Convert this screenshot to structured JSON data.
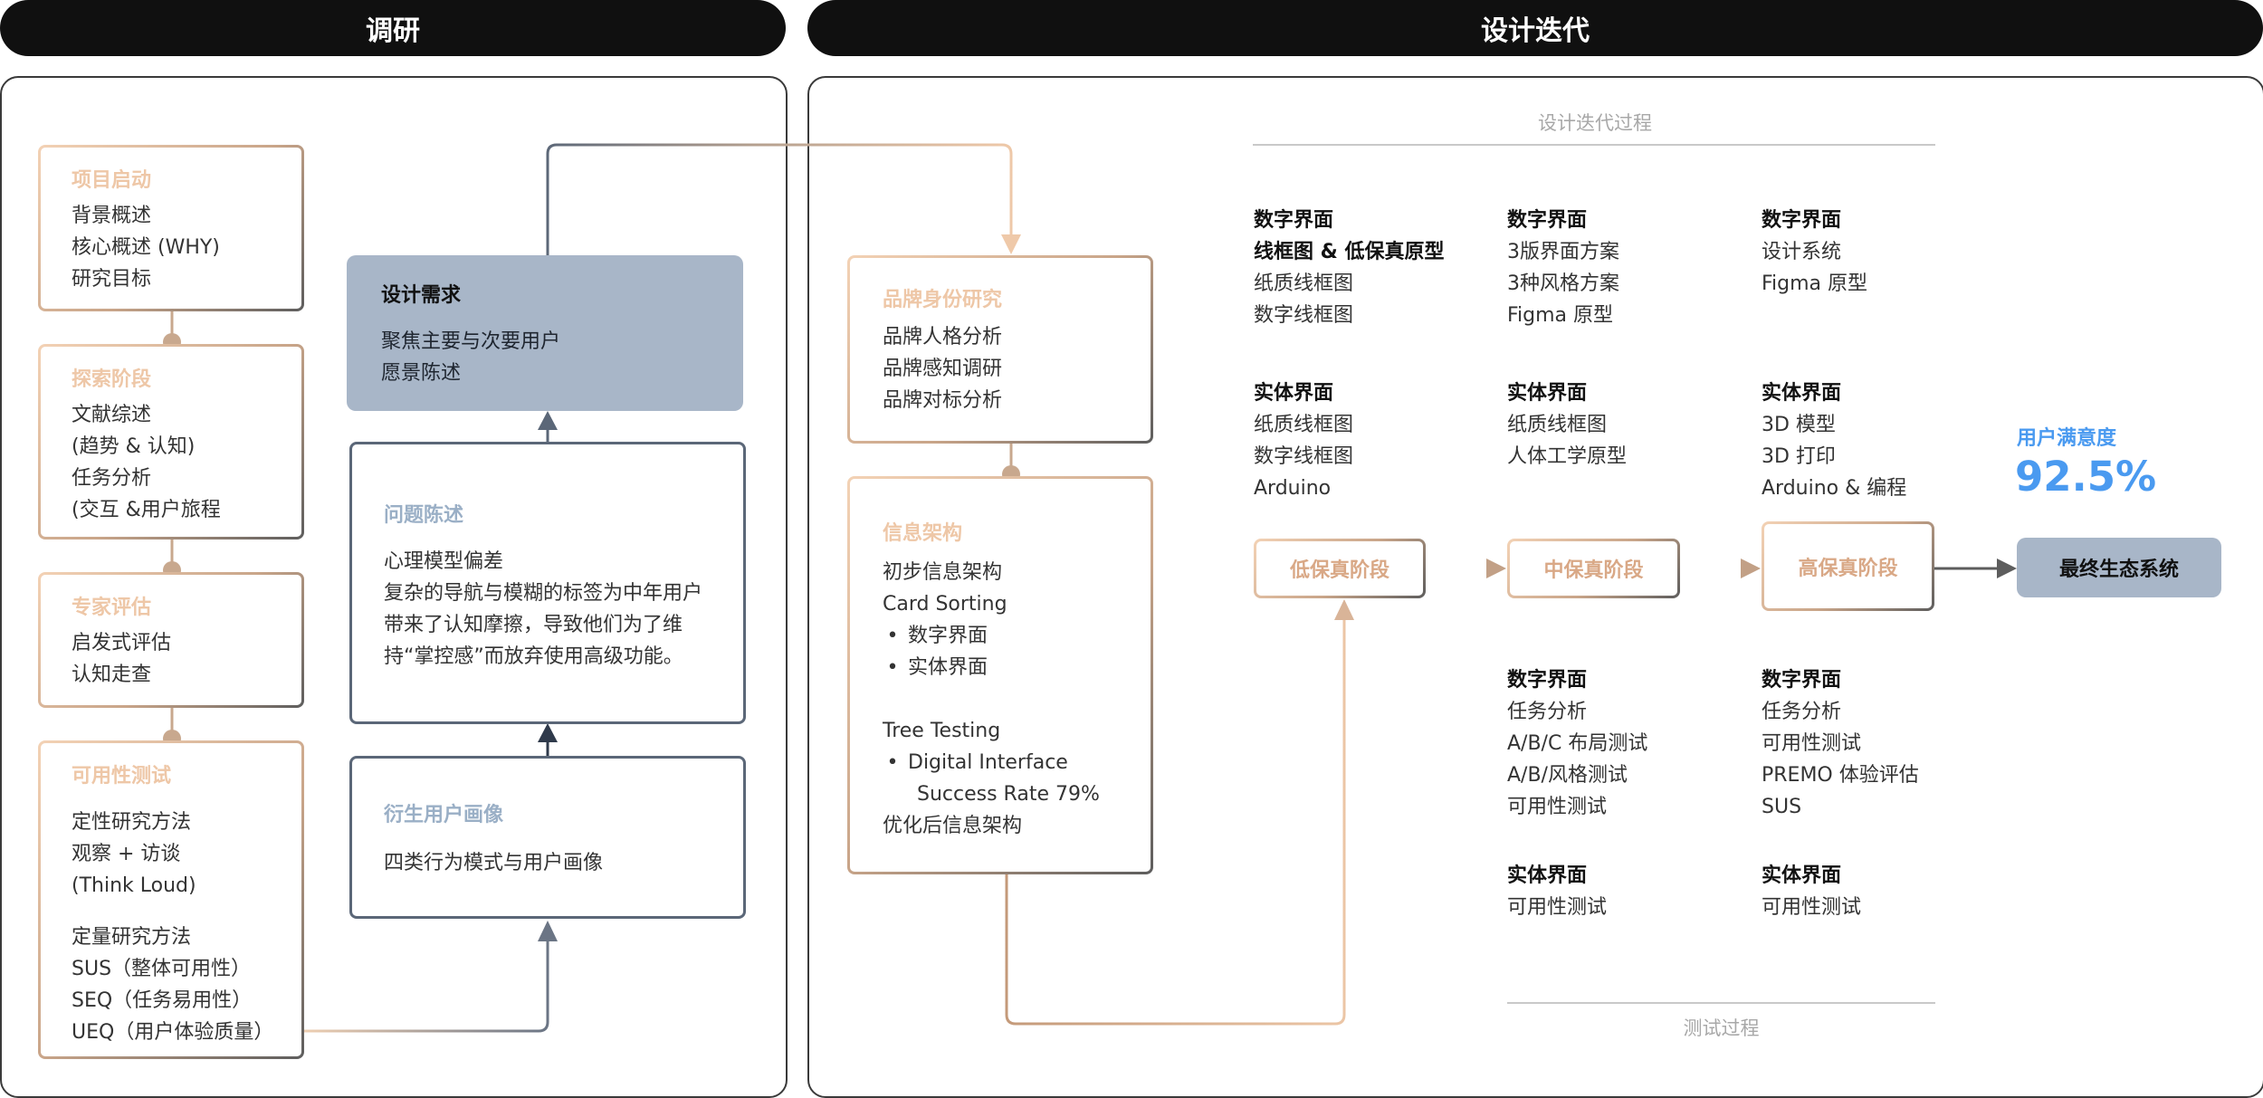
{
  "headers": {
    "research": "调研",
    "design": "设计迭代"
  },
  "research": {
    "kickoff": {
      "title": "项目启动",
      "lines": [
        "背景概述",
        "核心概述 (WHY)",
        "研究目标"
      ]
    },
    "explore": {
      "title": "探索阶段",
      "lines": [
        "文献综述",
        "(趋势 & 认知)",
        "任务分析",
        "(交互 &用户旅程"
      ]
    },
    "expert": {
      "title": "专家评估",
      "lines": [
        "启发式评估",
        "认知走查"
      ]
    },
    "usability": {
      "title": "可用性测试",
      "qual": [
        "定性研究方法",
        "观察 + 访谈",
        "(Think Loud)"
      ],
      "quant": [
        "定量研究方法",
        "SUS（整体可用性）",
        "SEQ（任务易用性）",
        "UEQ（用户体验质量）"
      ]
    },
    "requirements": {
      "title": "设计需求",
      "lines": [
        "聚焦主要与次要用户",
        "愿景陈述"
      ]
    },
    "problem": {
      "title": "问题陈述",
      "lines": [
        "心理模型偏差",
        "复杂的导航与模糊的标签为中年用户",
        "带来了认知摩擦，导致他们为了维",
        "持“掌控感”而放弃使用高级功能。"
      ]
    },
    "persona": {
      "title": "衍生用户画像",
      "lines": [
        "四类行为模式与用户画像"
      ]
    }
  },
  "design": {
    "process_caption": "设计迭代过程",
    "test_caption": "测试过程",
    "brand": {
      "title": "品牌身份研究",
      "lines": [
        "品牌人格分析",
        "品牌感知调研",
        "品牌对标分析"
      ]
    },
    "ia": {
      "title": "信息架构",
      "line1": "初步信息架构",
      "line2": "Card Sorting",
      "bullets1": [
        "数字界面",
        "实体界面"
      ],
      "line3": "Tree Testing",
      "bullet2a": "Digital Interface",
      "bullet2b": "Success Rate 79%",
      "line4": "优化后信息架构"
    },
    "stages": {
      "low": "低保真阶段",
      "mid": "中保真阶段",
      "high": "高保真阶段",
      "final": "最终生态系统"
    },
    "satisfaction": {
      "label": "用户满意度",
      "value": "92.5%"
    },
    "low_digital": {
      "head": "数字界面",
      "subhead": "线框图 & 低保真原型",
      "lines": [
        "纸质线框图",
        "数字线框图"
      ]
    },
    "low_physical": {
      "head": "实体界面",
      "lines": [
        "纸质线框图",
        "数字线框图",
        "Arduino"
      ]
    },
    "mid_digital": {
      "head": "数字界面",
      "lines": [
        "3版界面方案",
        "3种风格方案",
        "Figma 原型"
      ]
    },
    "mid_physical": {
      "head": "实体界面",
      "lines": [
        "纸质线框图",
        "人体工学原型"
      ]
    },
    "high_digital": {
      "head": "数字界面",
      "lines": [
        "设计系统",
        "Figma 原型"
      ]
    },
    "high_physical": {
      "head": "实体界面",
      "lines": [
        "3D 模型",
        "3D 打印",
        "Arduino & 编程"
      ]
    },
    "test_mid_digital": {
      "head": "数字界面",
      "lines": [
        "任务分析",
        "A/B/C 布局测试",
        "A/B/风格测试",
        "可用性测试"
      ]
    },
    "test_high_digital": {
      "head": "数字界面",
      "lines": [
        "任务分析",
        "可用性测试",
        "PREMO 体验评估",
        "SUS"
      ]
    },
    "test_mid_physical": {
      "head": "实体界面",
      "lines": [
        "可用性测试"
      ]
    },
    "test_high_physical": {
      "head": "实体界面",
      "lines": [
        "可用性测试"
      ]
    }
  }
}
